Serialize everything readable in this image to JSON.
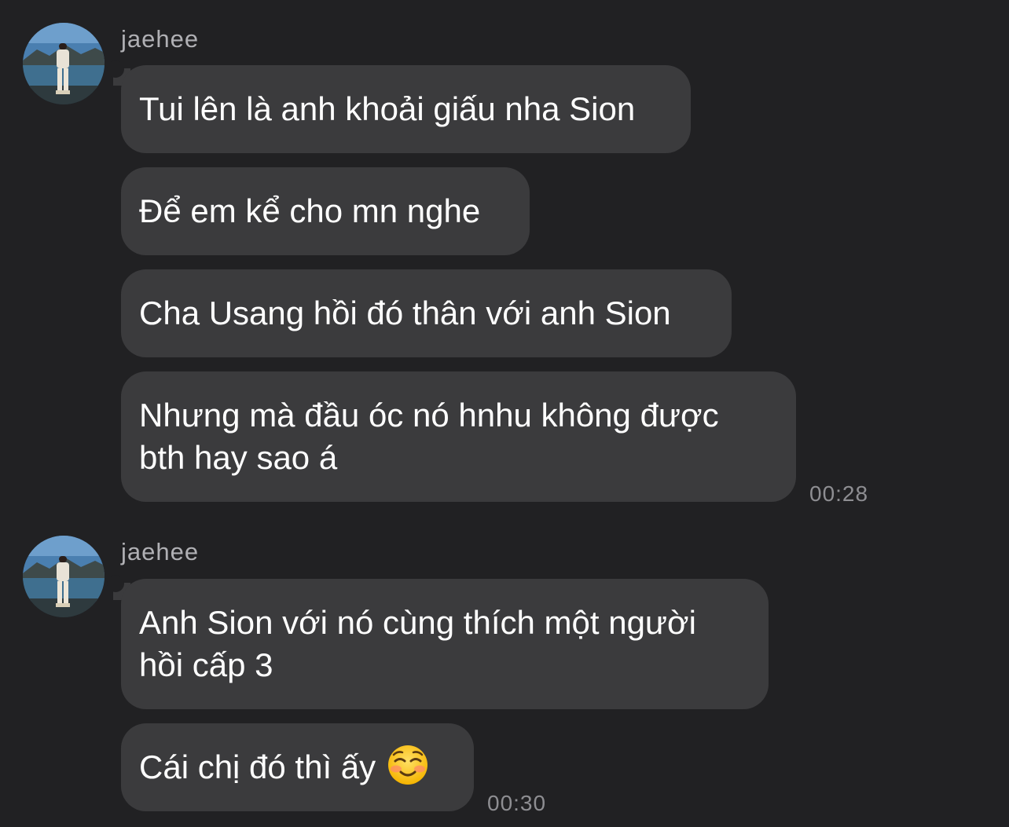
{
  "groups": [
    {
      "sender": "jaehee",
      "messages": [
        "Tui lên là anh khoải giấu nha Sion",
        "Để em kể cho mn nghe",
        "Cha Usang hồi đó thân với anh Sion",
        [
          "Nhưng mà đầu óc nó hnhu không được",
          "bth hay sao á"
        ]
      ],
      "timestamp": "00:28"
    },
    {
      "sender": "jaehee",
      "messages": [
        [
          "Anh Sion với nó cùng thích một người",
          "hồi cấp 3"
        ],
        "Cái chị đó thì ấy"
      ],
      "timestamp": "00:30"
    }
  ],
  "colors": {
    "background": "#212123",
    "bubble": "#3b3b3d",
    "text": "#ffffff",
    "sender": "#b0b0b4",
    "timestamp": "#8e8e92"
  },
  "icons": {
    "last_message_emoji": "smiling-face-emoji"
  }
}
